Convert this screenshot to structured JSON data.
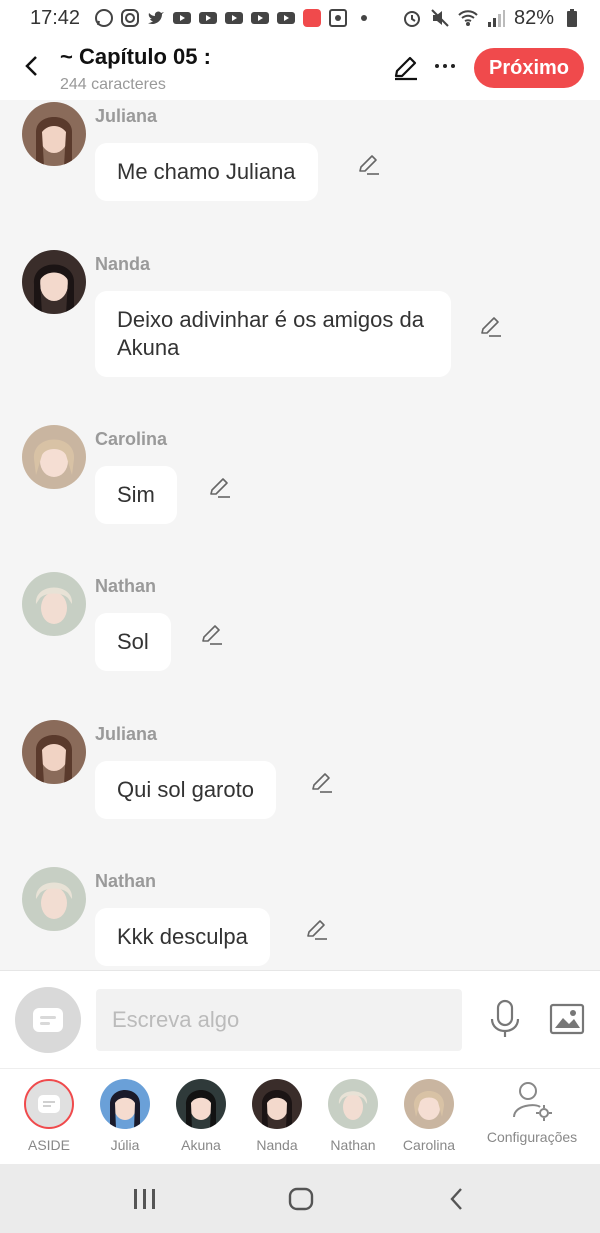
{
  "status_bar": {
    "time": "17:42",
    "battery": "82%",
    "left_icons": [
      "whatsapp-icon",
      "instagram-icon",
      "twitter-icon",
      "youtube-icon",
      "youtube-icon",
      "youtube-icon",
      "youtube-icon",
      "youtube-icon",
      "mangatoon-icon",
      "gallery-icon",
      "dot-icon"
    ],
    "right_icons": [
      "alarm-icon",
      "mute-icon",
      "wifi-icon",
      "signal-icon",
      "battery-icon"
    ]
  },
  "header": {
    "title": "~ Capítulo 05 :",
    "subtitle": "244 caracteres",
    "next_label": "Próximo"
  },
  "colors": {
    "accent": "#f04a4c",
    "chat_bg": "#f5f5f5",
    "bubble_bg": "#ffffff",
    "sender": "#9a9a9a"
  },
  "messages": [
    {
      "sender": "Juliana",
      "text": "Me chamo Juliana"
    },
    {
      "sender": "Nanda",
      "text": "Deixo adivinhar é os amigos da Akuna"
    },
    {
      "sender": "Carolina",
      "text": "Sim"
    },
    {
      "sender": "Nathan",
      "text": "Sol"
    },
    {
      "sender": "Juliana",
      "text": "Qui sol garoto"
    },
    {
      "sender": "Nathan",
      "text": "Kkk desculpa"
    }
  ],
  "input": {
    "placeholder": "Escreva algo"
  },
  "characters": [
    {
      "name": "ASIDE"
    },
    {
      "name": "Júlia"
    },
    {
      "name": "Akuna"
    },
    {
      "name": "Nanda"
    },
    {
      "name": "Nathan"
    },
    {
      "name": "Carolina"
    }
  ],
  "config_label": "Configurações",
  "nav": [
    "recents-icon",
    "home-icon",
    "back-icon"
  ]
}
